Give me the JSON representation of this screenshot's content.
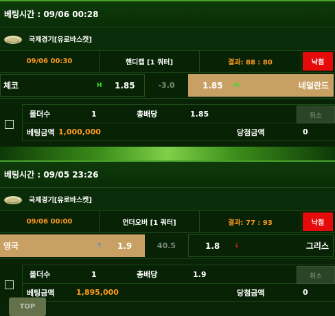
{
  "bets": [
    {
      "time_label": "베팅시간 : 09/06 00:28",
      "league": "국제경기[유로바스켓]",
      "match_time": "09/06 00:30",
      "market": "핸디캡 [1 쿼터]",
      "result_score": "결과: 88 : 80",
      "result_badge": "낙첨",
      "home_team": "체코",
      "home_mark": "H",
      "home_odds": "1.85",
      "line": "-3.0",
      "away_odds": "1.85",
      "away_mark": "H",
      "away_team": "네덜란드",
      "selected": "away",
      "folder_label": "폴더수",
      "folder_count": "1",
      "total_odds_label": "총배당",
      "total_odds": "1.85",
      "bet_amount_label": "베팅금액",
      "bet_amount": "1,000,000",
      "win_amount_label": "당첨금액",
      "win_amount": "0",
      "cancel_label": "취소"
    },
    {
      "time_label": "베팅시간 : 09/05 23:26",
      "league": "국제경기[유로바스켓]",
      "match_time": "09/06 00:00",
      "market": "언더오버 [1 쿼터]",
      "result_score": "결과: 77 : 93",
      "result_badge": "낙첨",
      "home_team": "영국",
      "home_mark": "↑",
      "home_odds": "1.9",
      "line": "40.5",
      "away_odds": "1.8",
      "away_mark": "↓",
      "away_team": "그리스",
      "selected": "home",
      "folder_label": "폴더수",
      "folder_count": "1",
      "total_odds_label": "총배당",
      "total_odds": "1.9",
      "bet_amount_label": "베팅금액",
      "bet_amount": "1,895,000",
      "win_amount_label": "당첨금액",
      "win_amount": "0",
      "cancel_label": "취소"
    }
  ],
  "top_button": "TOP",
  "colors": {
    "accent_orange": "#ff9a1f",
    "lost_red": "#e50b0b",
    "selected_gold": "#c9a064",
    "bg_dark_green": "#082306"
  },
  "icons": {
    "league": "basketball-icon"
  }
}
